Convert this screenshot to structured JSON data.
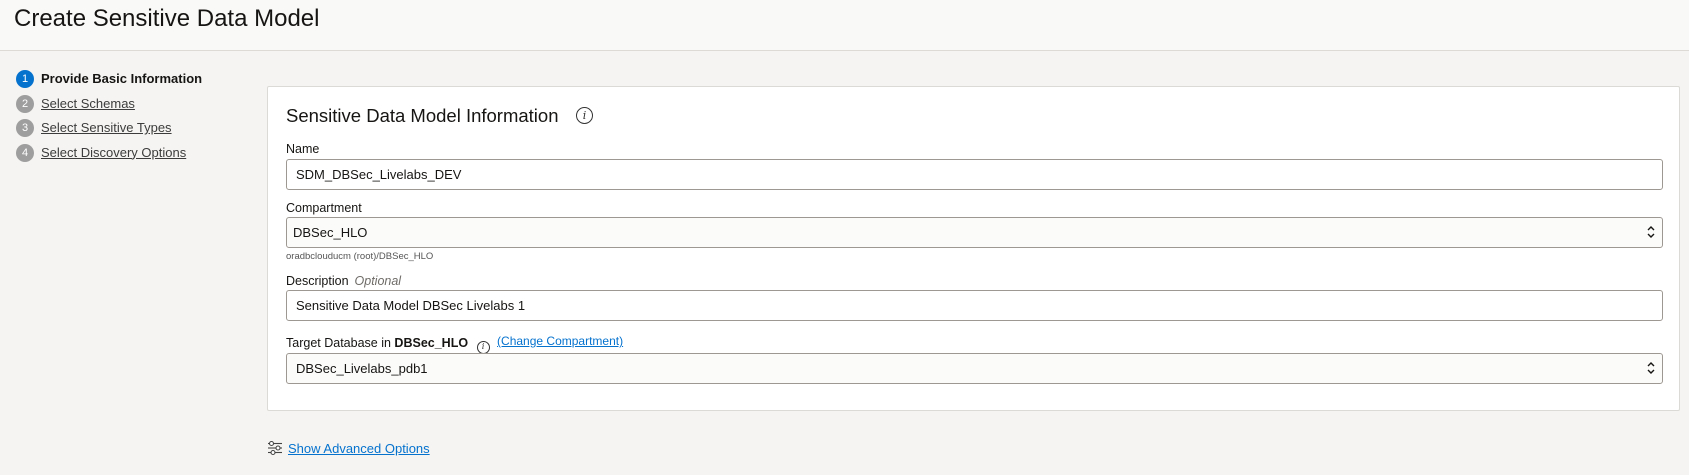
{
  "header": {
    "title": "Create Sensitive Data Model"
  },
  "steps": [
    {
      "number": "1",
      "label": "Provide Basic Information",
      "active": true
    },
    {
      "number": "2",
      "label": "Select Schemas",
      "active": false
    },
    {
      "number": "3",
      "label": "Select Sensitive Types",
      "active": false
    },
    {
      "number": "4",
      "label": "Select Discovery Options",
      "active": false
    }
  ],
  "panel": {
    "title": "Sensitive Data Model Information",
    "info_icon": "info-icon",
    "name": {
      "label": "Name",
      "value": "SDM_DBSec_Livelabs_DEV"
    },
    "compartment": {
      "label": "Compartment",
      "value": "DBSec_HLO",
      "hint": "oradbclouducm (root)/DBSec_HLO"
    },
    "description": {
      "label": "Description",
      "optional": "Optional",
      "value": "Sensitive Data Model DBSec Livelabs 1"
    },
    "target": {
      "label": "Target Database in",
      "compartment_name": "DBSec_HLO",
      "change_link": "(Change Compartment)",
      "value": "DBSec_Livelabs_pdb1"
    }
  },
  "advanced": {
    "label": "Show Advanced Options",
    "icon": "sliders-icon"
  },
  "colors": {
    "accent": "#0572ce",
    "step_inactive": "#9e9e9e"
  }
}
